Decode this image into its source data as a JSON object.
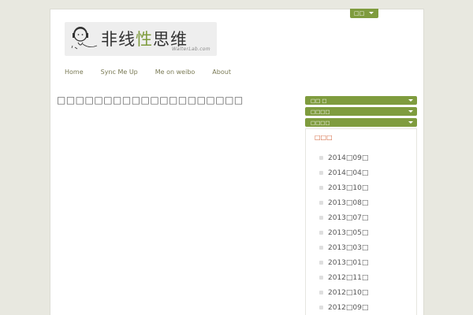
{
  "colors": {
    "accent": "#7f9c3e",
    "archive_title": "#d0592e",
    "background": "#e8e8e0"
  },
  "lang_selector": {
    "label": "□□"
  },
  "logo": {
    "icon": "headphone-boy-icon",
    "title_cn_1": "非线",
    "title_cn_2": "性",
    "title_cn_3": "思维",
    "subtitle": "WalterLab.com"
  },
  "nav": {
    "items": [
      {
        "label": "Home"
      },
      {
        "label": "Sync Me Up"
      },
      {
        "label": "Me on weibo"
      },
      {
        "label": "About"
      }
    ]
  },
  "post": {
    "title": "□□□□□□□□□□□□□□□□□□□□"
  },
  "sidebar": {
    "widgets": [
      {
        "label": "□□ □"
      },
      {
        "label": "□□□□"
      },
      {
        "label": "□□□□"
      }
    ],
    "archive": {
      "title": "□□□",
      "items": [
        {
          "label": "2014□09□"
        },
        {
          "label": "2014□04□"
        },
        {
          "label": "2013□10□"
        },
        {
          "label": "2013□08□"
        },
        {
          "label": "2013□07□"
        },
        {
          "label": "2013□05□"
        },
        {
          "label": "2013□03□"
        },
        {
          "label": "2013□01□"
        },
        {
          "label": "2012□11□"
        },
        {
          "label": "2012□10□"
        },
        {
          "label": "2012□09□"
        }
      ]
    }
  }
}
